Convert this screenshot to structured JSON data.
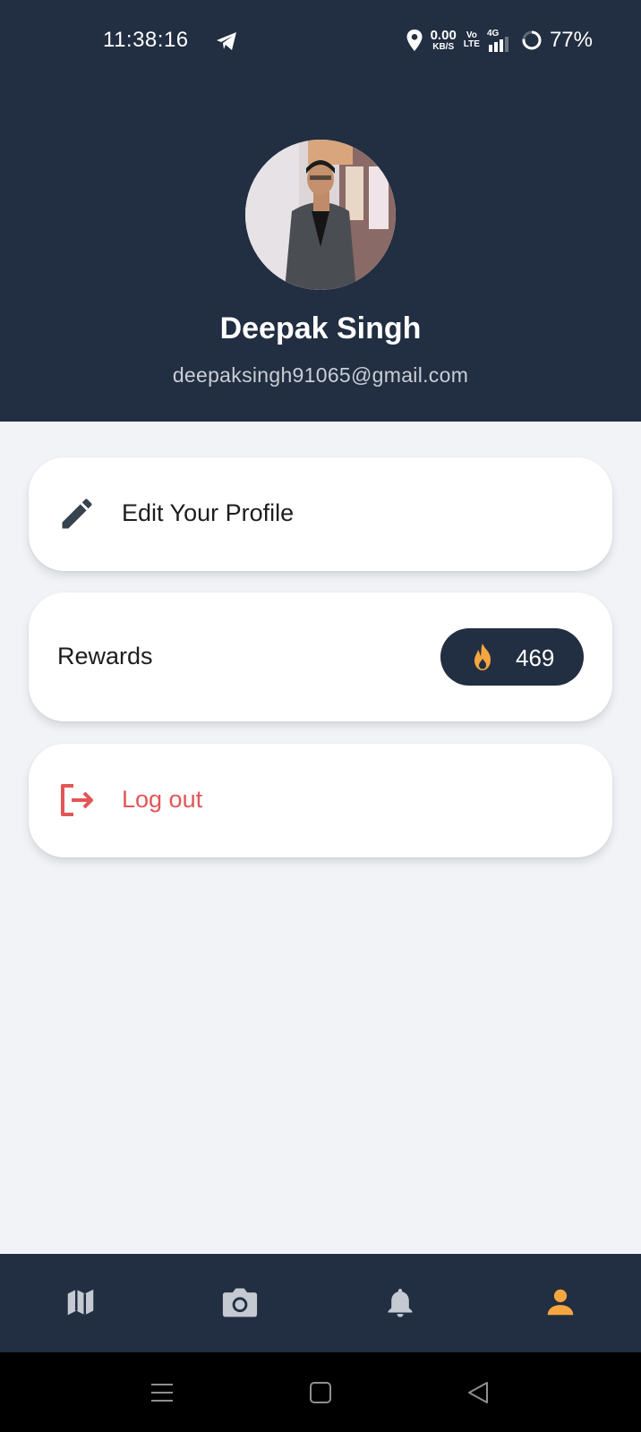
{
  "status_bar": {
    "time": "11:38:16",
    "net_speed_value": "0.00",
    "net_speed_unit": "KB/S",
    "volte_top": "Vo",
    "volte_bottom": "LTE",
    "network_type": "4G",
    "battery": "77%"
  },
  "profile": {
    "name": "Deepak Singh",
    "email": "deepaksingh91065@gmail.com"
  },
  "menu": {
    "edit_profile_label": "Edit Your Profile",
    "rewards_label": "Rewards",
    "rewards_count": "469",
    "logout_label": "Log out"
  },
  "bottom_nav": {
    "items": [
      {
        "icon": "map-icon",
        "active": false
      },
      {
        "icon": "camera-icon",
        "active": false
      },
      {
        "icon": "bell-icon",
        "active": false
      },
      {
        "icon": "person-icon",
        "active": true
      }
    ]
  },
  "colors": {
    "header_bg": "#222e41",
    "page_bg": "#f1f3f7",
    "card_bg": "#ffffff",
    "logout_red": "#e25656",
    "active_orange": "#f5a640",
    "inactive_icon": "#c4c9d2"
  }
}
